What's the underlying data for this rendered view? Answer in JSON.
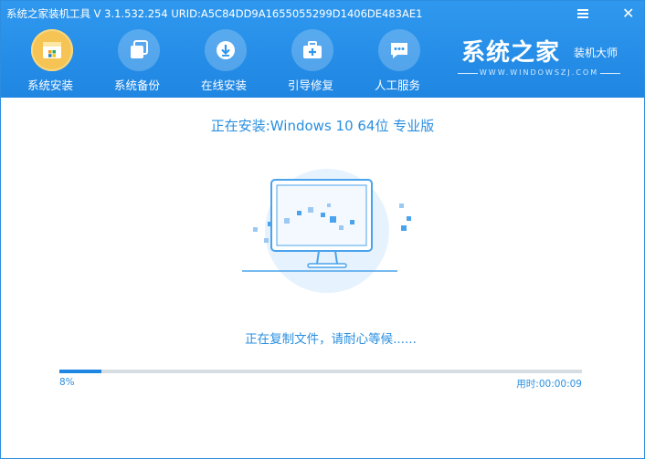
{
  "window": {
    "title": "系统之家装机工具 V 3.1.532.254 URID:A5C84DD9A1655055299D1406DE483AE1"
  },
  "nav": {
    "items": [
      {
        "label": "系统安装",
        "icon": "install-box-icon",
        "active": true
      },
      {
        "label": "系统备份",
        "icon": "backup-layers-icon",
        "active": false
      },
      {
        "label": "在线安装",
        "icon": "download-arrow-icon",
        "active": false
      },
      {
        "label": "引导修复",
        "icon": "toolbox-icon",
        "active": false
      },
      {
        "label": "人工服务",
        "icon": "chat-bubble-icon",
        "active": false
      }
    ]
  },
  "brand": {
    "name": "系统之家",
    "subtitle": "装机大师",
    "url": "WWW.WINDOWSZJ.COM"
  },
  "main": {
    "install_title": "正在安装:Windows 10 64位 专业版",
    "status": "正在复制文件，请耐心等候......",
    "progress_percent": 8,
    "progress_label": "8%",
    "elapsed": "用时:00:00:09"
  },
  "colors": {
    "accent": "#1f86e2",
    "text_accent": "#2a8fe0",
    "active_icon": "#f6c454"
  }
}
